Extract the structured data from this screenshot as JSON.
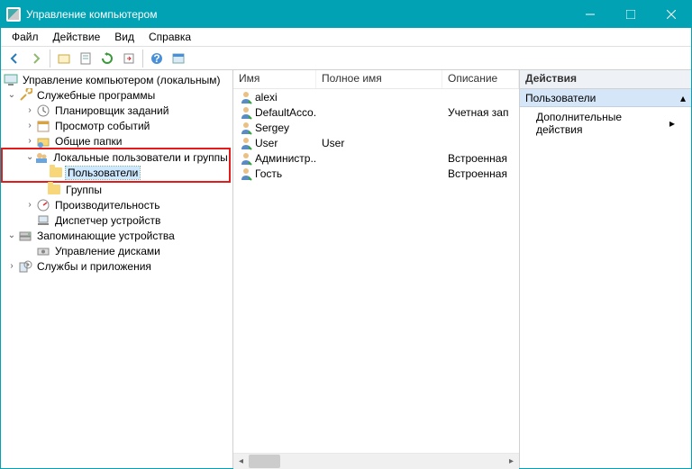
{
  "title": "Управление компьютером",
  "menubar": [
    "Файл",
    "Действие",
    "Вид",
    "Справка"
  ],
  "tree": {
    "root": "Управление компьютером (локальным)",
    "service_programs": "Служебные программы",
    "task_scheduler": "Планировщик заданий",
    "event_viewer": "Просмотр событий",
    "shared_folders": "Общие папки",
    "local_users_groups": "Локальные пользователи и группы",
    "users": "Пользователи",
    "groups": "Группы",
    "performance": "Производительность",
    "device_manager": "Диспетчер устройств",
    "storage": "Запоминающие устройства",
    "disk_mgmt": "Управление дисками",
    "services_apps": "Службы и приложения"
  },
  "list": {
    "columns": {
      "name": "Имя",
      "fullname": "Полное имя",
      "desc": "Описание"
    },
    "rows": [
      {
        "name": "alexi",
        "fullname": "",
        "desc": ""
      },
      {
        "name": "DefaultAcco...",
        "fullname": "",
        "desc": "Учетная зап"
      },
      {
        "name": "Sergey",
        "fullname": "",
        "desc": ""
      },
      {
        "name": "User",
        "fullname": "User",
        "desc": ""
      },
      {
        "name": "Администр...",
        "fullname": "",
        "desc": "Встроенная"
      },
      {
        "name": "Гость",
        "fullname": "",
        "desc": "Встроенная"
      }
    ]
  },
  "actions": {
    "header": "Действия",
    "section": "Пользователи",
    "more": "Дополнительные действия"
  }
}
